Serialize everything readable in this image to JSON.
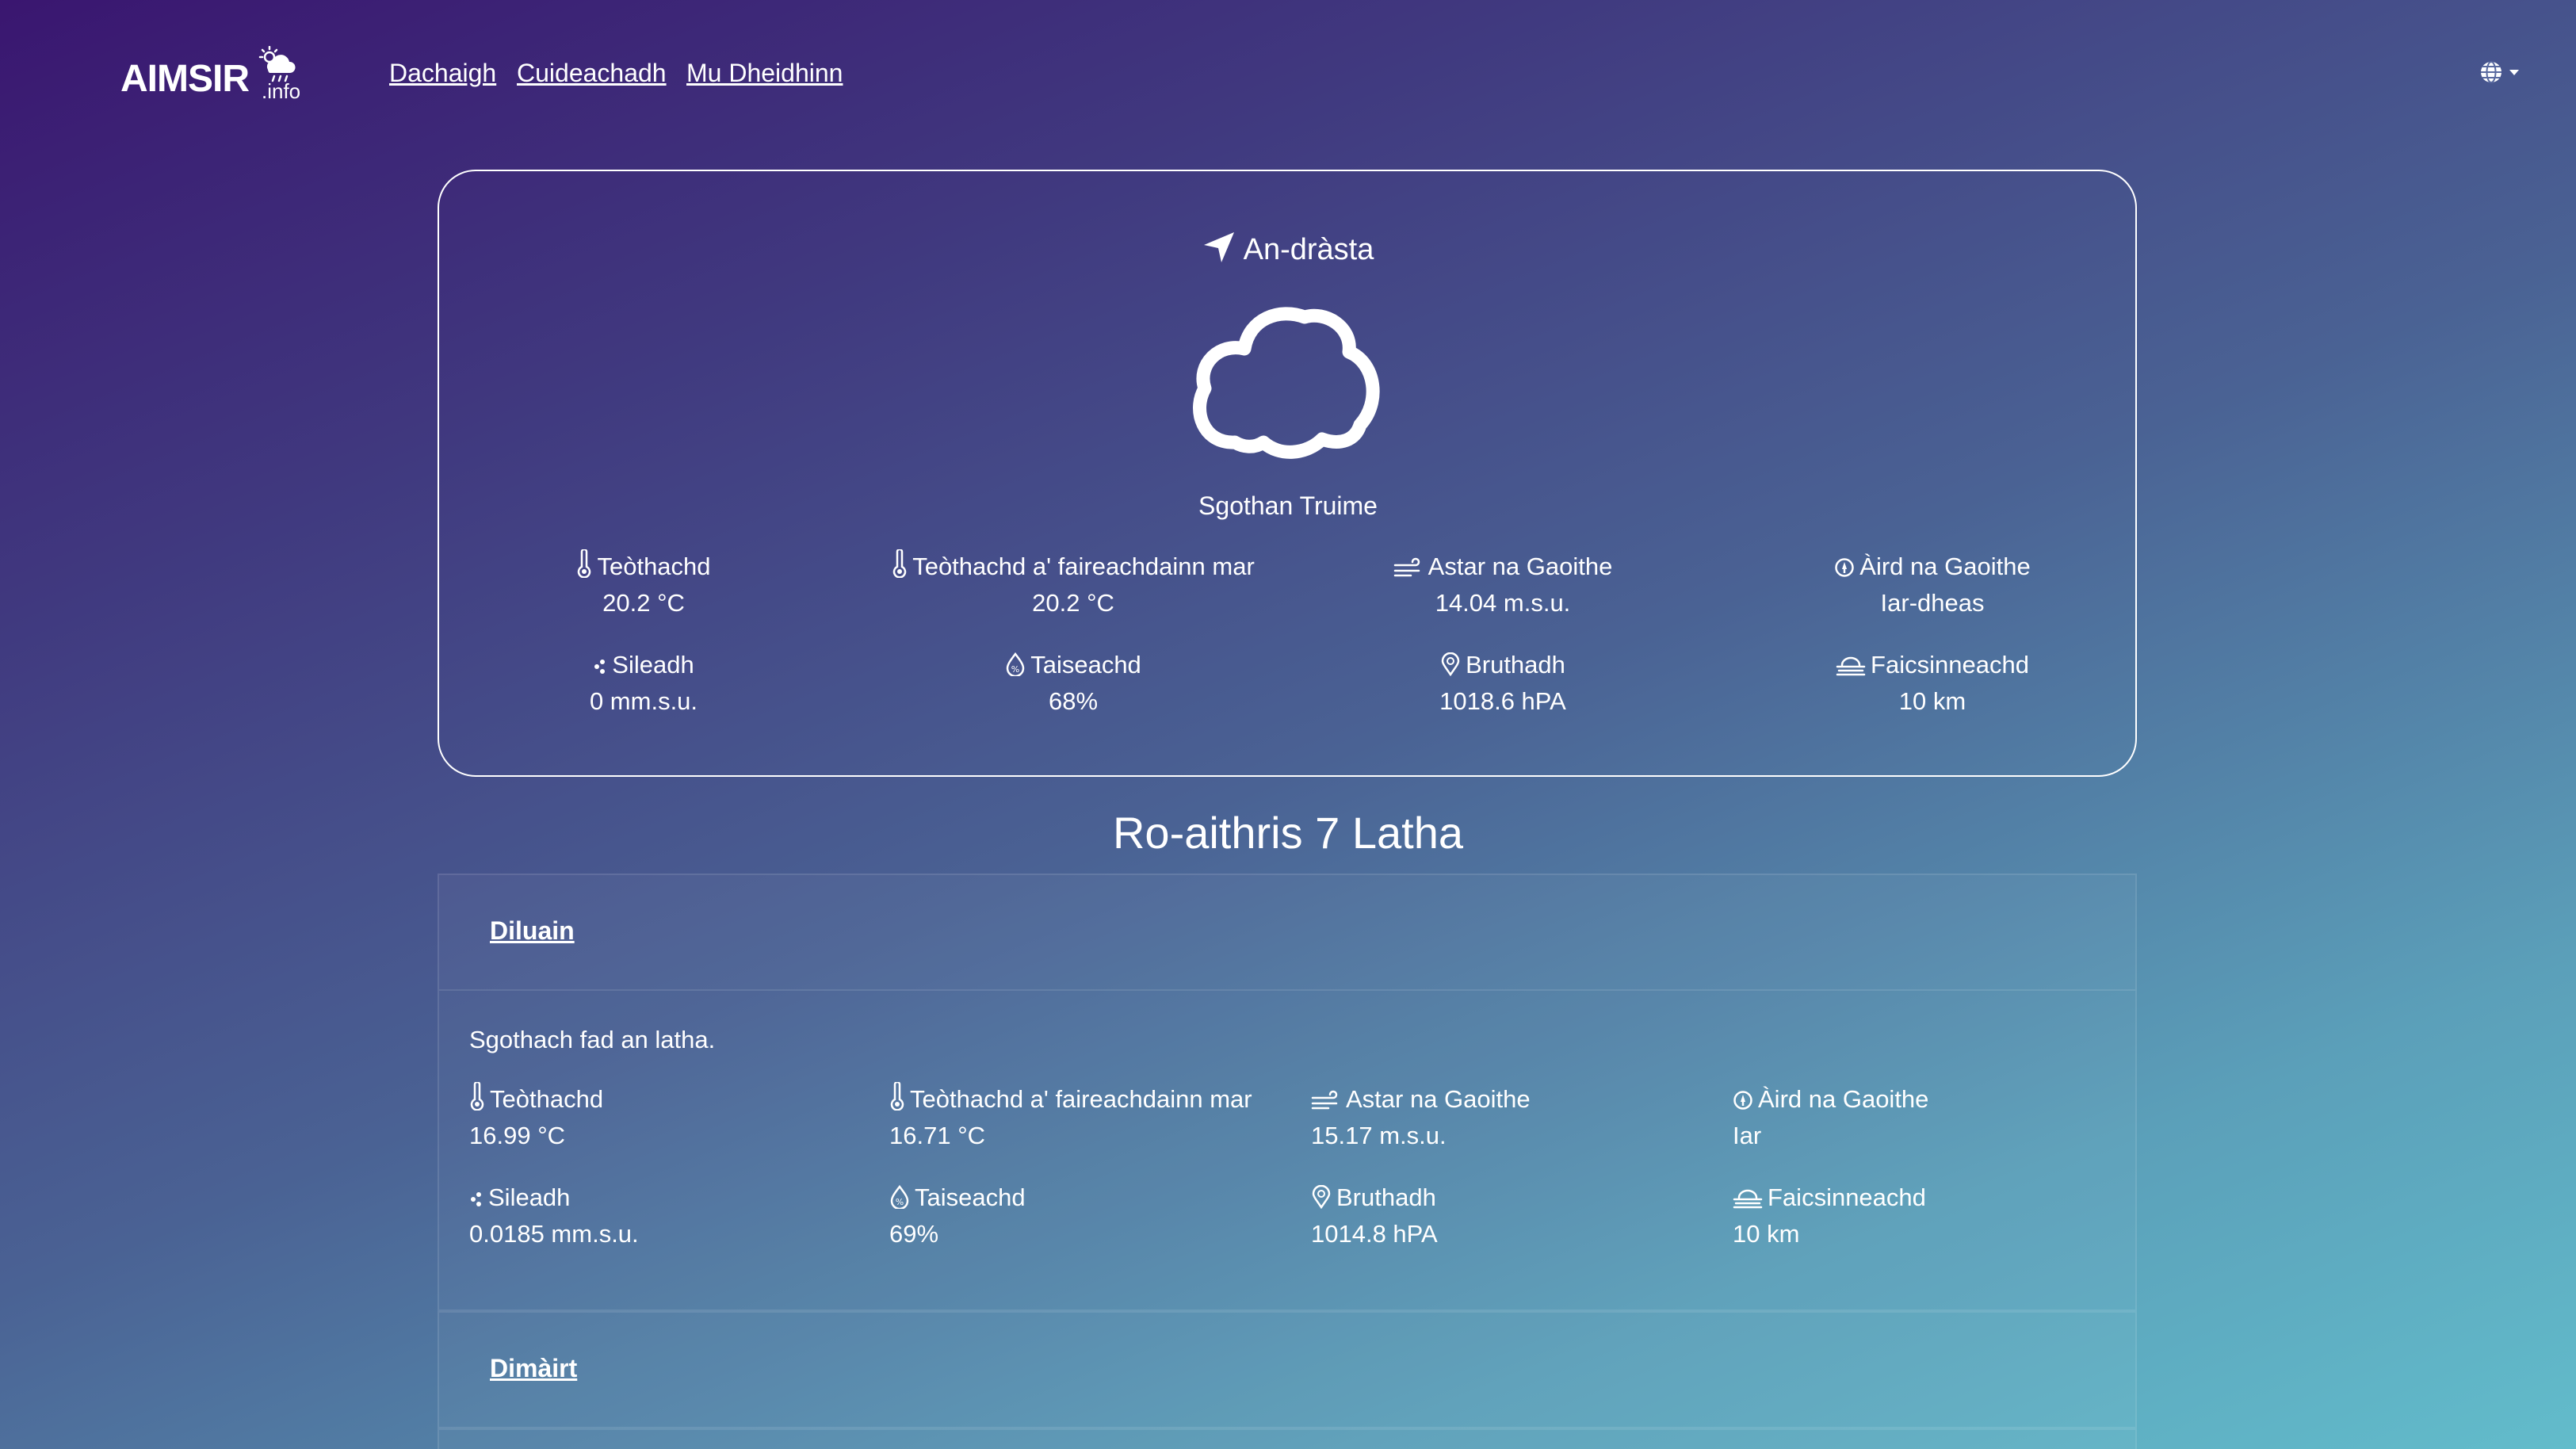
{
  "logo": {
    "text": "AIMSIR",
    "suffix": ".info",
    "icon": "sun-cloud-rain-icon"
  },
  "nav": {
    "links": [
      "Dachaigh",
      "Cuideachadh",
      "Mu Dheidhinn"
    ],
    "language_icon": "globe-icon"
  },
  "current": {
    "title": "An-dràsta",
    "title_icon": "location-arrow-icon",
    "condition_icon": "cloud-icon",
    "condition": "Sgothan Truime",
    "stats": [
      {
        "icon": "thermometer-icon",
        "label": "Teòthachd",
        "value": "20.2 °C"
      },
      {
        "icon": "thermometer-icon",
        "label": "Teòthachd a' faireachdainn mar",
        "value": "20.2 °C"
      },
      {
        "icon": "wind-icon",
        "label": "Astar na Gaoithe",
        "value": "14.04 m.s.u."
      },
      {
        "icon": "compass-icon",
        "label": "Àird na Gaoithe",
        "value": "Iar-dheas"
      },
      {
        "icon": "precipitation-icon",
        "label": "Sileadh",
        "value": "0 mm.s.u."
      },
      {
        "icon": "humidity-drop-icon",
        "label": "Taiseachd",
        "value": "68%"
      },
      {
        "icon": "pressure-icon",
        "label": "Bruthadh",
        "value": "1018.6 hPA"
      },
      {
        "icon": "fog-visibility-icon",
        "label": "Faicsinneachd",
        "value": "10 km"
      }
    ]
  },
  "forecast": {
    "title": "Ro-aithris 7 Latha",
    "days": [
      {
        "name": "Diluain",
        "summary": "Sgothach fad an latha.",
        "stats": [
          {
            "icon": "thermometer-icon",
            "label": "Teòthachd",
            "value": "16.99 °C"
          },
          {
            "icon": "thermometer-icon",
            "label": "Teòthachd a' faireachdainn mar",
            "value": "16.71 °C"
          },
          {
            "icon": "wind-icon",
            "label": "Astar na Gaoithe",
            "value": "15.17 m.s.u."
          },
          {
            "icon": "compass-icon",
            "label": "Àird na Gaoithe",
            "value": "Iar"
          },
          {
            "icon": "precipitation-icon",
            "label": "Sileadh",
            "value": "0.0185 mm.s.u."
          },
          {
            "icon": "humidity-drop-icon",
            "label": "Taiseachd",
            "value": "69%"
          },
          {
            "icon": "pressure-icon",
            "label": "Bruthadh",
            "value": "1014.8 hPA"
          },
          {
            "icon": "fog-visibility-icon",
            "label": "Faicsinneachd",
            "value": "10 km"
          }
        ]
      },
      {
        "name": "Dimàirt"
      }
    ]
  }
}
